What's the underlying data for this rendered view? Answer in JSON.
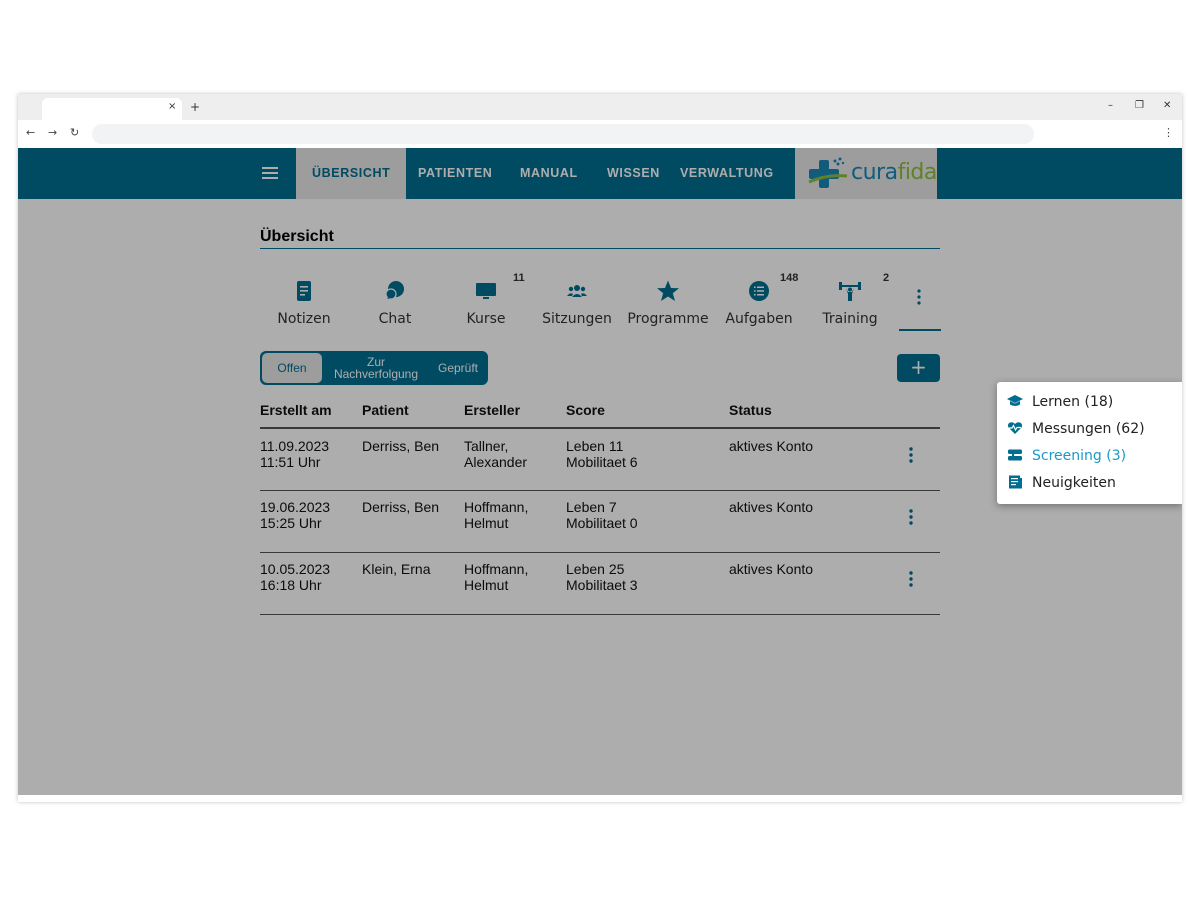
{
  "colors": {
    "brand": "#006d91",
    "accent": "#1a9ac9",
    "logo_green": "#8cbf3f"
  },
  "browser": {
    "tab_close": "×",
    "new_tab": "+",
    "minimize": "–",
    "restore": "❐",
    "close": "✕",
    "back": "←",
    "forward": "→",
    "reload": "↻",
    "menu": "⋮"
  },
  "nav": {
    "items": [
      {
        "label": "ÜBERSICHT",
        "active": true
      },
      {
        "label": "PATIENTEN"
      },
      {
        "label": "MANUAL"
      },
      {
        "label": "WISSEN"
      },
      {
        "label": "VERWALTUNG"
      }
    ],
    "logo": {
      "part1": "cura",
      "part2": "fida"
    }
  },
  "page": {
    "title": "Übersicht"
  },
  "features": [
    {
      "label": "Notizen",
      "icon": "note-icon"
    },
    {
      "label": "Chat",
      "icon": "chat-icon"
    },
    {
      "label": "Kurse",
      "icon": "monitor-icon",
      "badge": "11"
    },
    {
      "label": "Sitzungen",
      "icon": "group-icon"
    },
    {
      "label": "Programme",
      "icon": "star-icon"
    },
    {
      "label": "Aufgaben",
      "icon": "list-icon",
      "badge": "148"
    },
    {
      "label": "Training",
      "icon": "fitness-icon",
      "badge": "2"
    }
  ],
  "filter": {
    "segments": [
      {
        "label": "Offen",
        "active": true
      },
      {
        "label": "Zur Nachverfolgung"
      },
      {
        "label": "Geprüft"
      }
    ],
    "add_label": "+"
  },
  "table": {
    "headers": [
      "Erstellt am",
      "Patient",
      "Ersteller",
      "Score",
      "Status"
    ],
    "rows": [
      {
        "date": "11.09.2023",
        "time": "11:51 Uhr",
        "patient": "Derriss, Ben",
        "creator1": "Tallner,",
        "creator2": "Alexander",
        "score1": "Leben 11",
        "score2": "Mobilitaet 6",
        "status": "aktives Konto"
      },
      {
        "date": "19.06.2023",
        "time": "15:25 Uhr",
        "patient": "Derriss, Ben",
        "creator1": "Hoffmann,",
        "creator2": "Helmut",
        "score1": "Leben 7",
        "score2": "Mobilitaet 0",
        "status": "aktives Konto"
      },
      {
        "date": "10.05.2023",
        "time": "16:18 Uhr",
        "patient": "Klein, Erna",
        "creator1": "Hoffmann,",
        "creator2": "Helmut",
        "score1": "Leben 25",
        "score2": "Mobilitaet 3",
        "status": "aktives Konto"
      }
    ]
  },
  "more_menu": {
    "items": [
      {
        "label": "Lernen (18)",
        "icon": "graduation-cap-icon"
      },
      {
        "label": "Messungen (62)",
        "icon": "heart-pulse-icon"
      },
      {
        "label": "Screening (3)",
        "icon": "screening-icon",
        "active": true
      },
      {
        "label": "Neuigkeiten",
        "icon": "news-icon"
      }
    ]
  }
}
